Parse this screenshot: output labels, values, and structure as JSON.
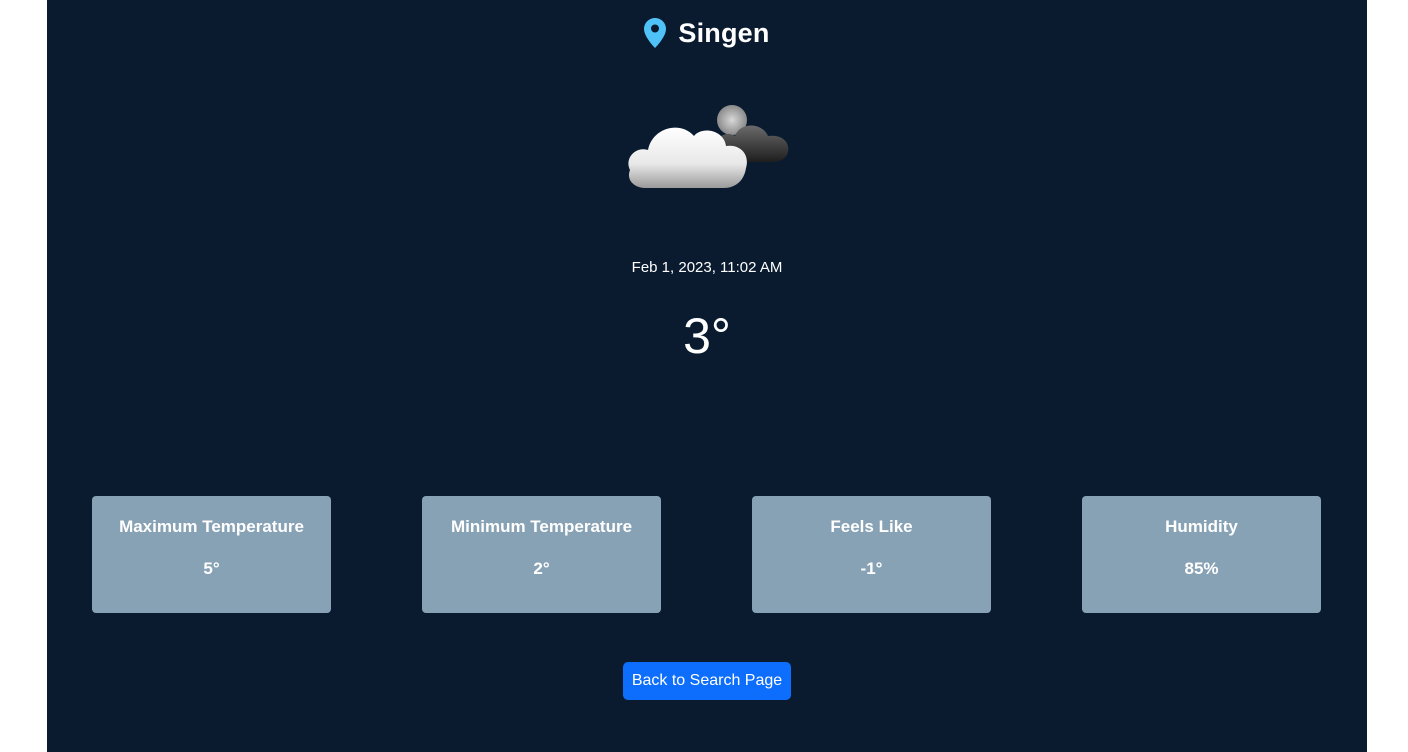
{
  "location": {
    "city": "Singen",
    "icon": "map-pin-icon",
    "icon_color": "#4fc3f7"
  },
  "weather": {
    "icon": "cloudy-night-icon",
    "datetime": "Feb 1, 2023, 11:02 AM",
    "temperature": "3°"
  },
  "stats": [
    {
      "label": "Maximum Temperature",
      "value": "5°"
    },
    {
      "label": "Minimum Temperature",
      "value": "2°"
    },
    {
      "label": "Feels Like",
      "value": "-1°"
    },
    {
      "label": "Humidity",
      "value": "85%"
    }
  ],
  "actions": {
    "back_label": "Back to Search Page"
  },
  "colors": {
    "background": "#0a1b30",
    "card": "#88a2b5",
    "button": "#0d6efd"
  }
}
